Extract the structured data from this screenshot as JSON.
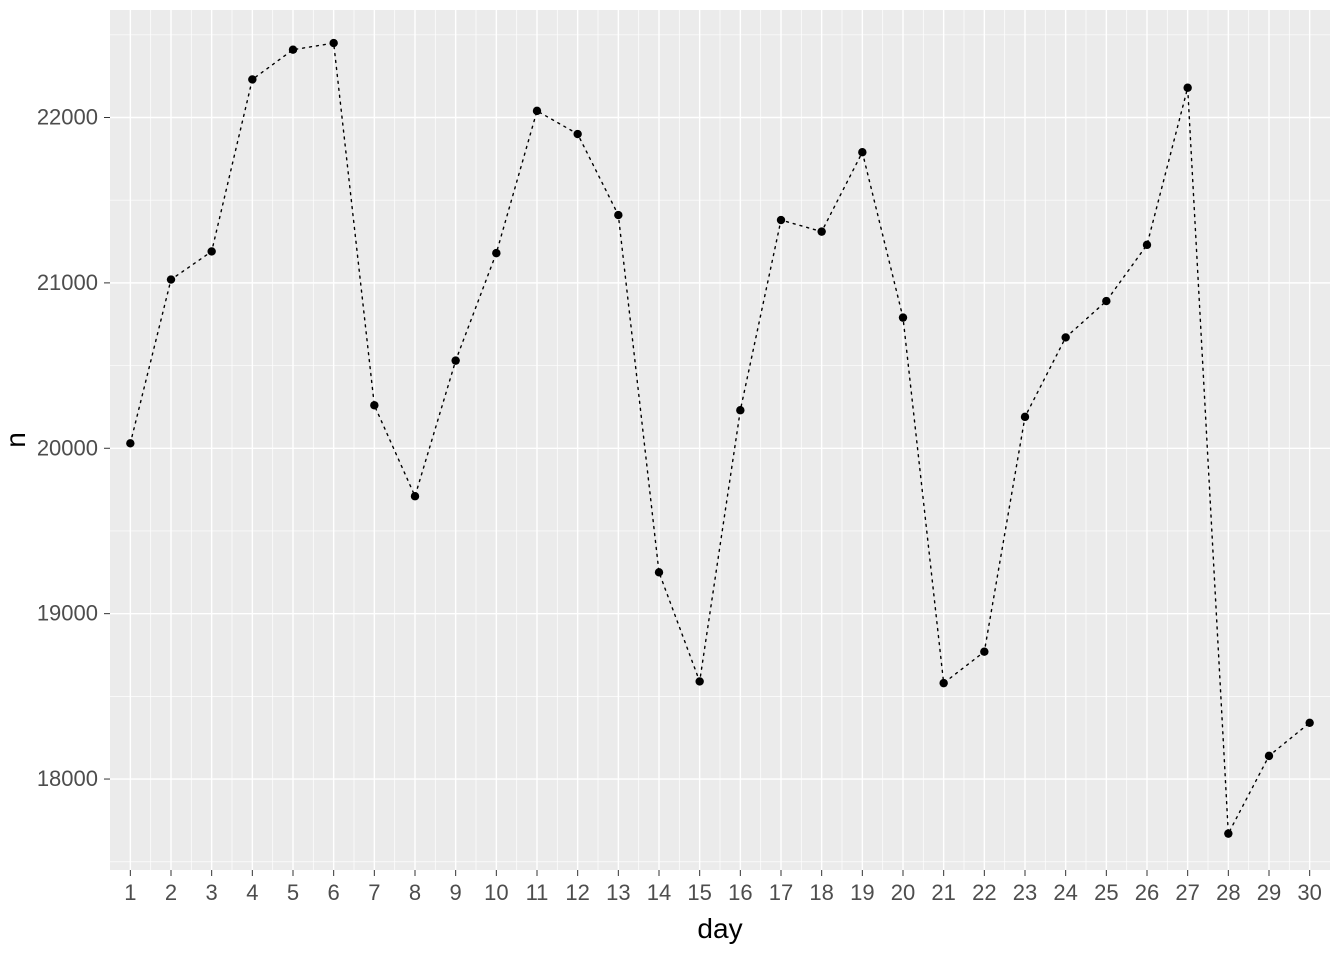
{
  "chart_data": {
    "type": "line",
    "x": [
      1,
      2,
      3,
      4,
      5,
      6,
      7,
      8,
      9,
      10,
      11,
      12,
      13,
      14,
      15,
      16,
      17,
      18,
      19,
      20,
      21,
      22,
      23,
      24,
      25,
      26,
      27,
      28,
      29,
      30
    ],
    "values": [
      20030,
      21020,
      21190,
      22230,
      22410,
      22450,
      20260,
      19710,
      20530,
      21180,
      22040,
      21900,
      21410,
      19250,
      18590,
      20230,
      21380,
      21310,
      21790,
      20790,
      18580,
      18770,
      20190,
      20670,
      20890,
      21230,
      22180,
      17670,
      18140,
      18340
    ],
    "xlabel": "day",
    "ylabel": "n",
    "title": "",
    "xlim": [
      0.5,
      30.5
    ],
    "ylim": [
      17450,
      22650
    ],
    "y_breaks": [
      18000,
      19000,
      20000,
      21000,
      22000
    ],
    "x_breaks": [
      1,
      2,
      3,
      4,
      5,
      6,
      7,
      8,
      9,
      10,
      11,
      12,
      13,
      14,
      15,
      16,
      17,
      18,
      19,
      20,
      21,
      22,
      23,
      24,
      25,
      26,
      27,
      28,
      29,
      30
    ],
    "point_shape": "circle",
    "line_style": "dotted",
    "grid": true
  },
  "axis": {
    "x_title": "day",
    "y_title": "n"
  }
}
